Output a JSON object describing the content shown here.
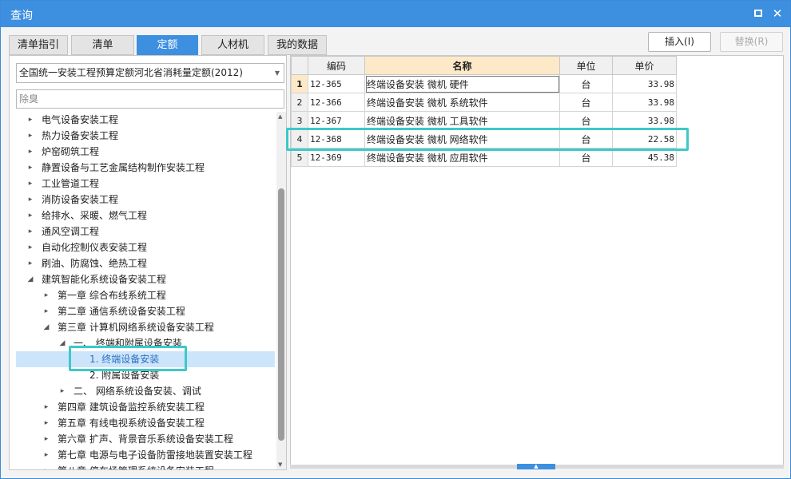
{
  "window": {
    "title": "查询"
  },
  "tabs": [
    {
      "label": "清单指引"
    },
    {
      "label": "清单"
    },
    {
      "label": "定额"
    },
    {
      "label": "人材机"
    },
    {
      "label": "我的数据"
    }
  ],
  "actions": {
    "insert": "插入(I)",
    "replace": "替换(R)"
  },
  "left": {
    "library": "全国统一安装工程预算定额河北省消耗量定额(2012)",
    "search_placeholder": "除臭",
    "tree": [
      {
        "label": "电气设备安装工程",
        "indent": 0,
        "toggle": "▸"
      },
      {
        "label": "热力设备安装工程",
        "indent": 0,
        "toggle": "▸"
      },
      {
        "label": "炉窑砌筑工程",
        "indent": 0,
        "toggle": "▸"
      },
      {
        "label": "静置设备与工艺金属结构制作安装工程",
        "indent": 0,
        "toggle": "▸"
      },
      {
        "label": "工业管道工程",
        "indent": 0,
        "toggle": "▸"
      },
      {
        "label": "消防设备安装工程",
        "indent": 0,
        "toggle": "▸"
      },
      {
        "label": "给排水、采暖、燃气工程",
        "indent": 0,
        "toggle": "▸"
      },
      {
        "label": "通风空调工程",
        "indent": 0,
        "toggle": "▸"
      },
      {
        "label": "自动化控制仪表安装工程",
        "indent": 0,
        "toggle": "▸"
      },
      {
        "label": "刷油、防腐蚀、绝热工程",
        "indent": 0,
        "toggle": "▸"
      },
      {
        "label": "建筑智能化系统设备安装工程",
        "indent": 0,
        "toggle": "◢"
      },
      {
        "label": "第一章 综合布线系统工程",
        "indent": 1,
        "toggle": "▸"
      },
      {
        "label": "第二章 通信系统设备安装工程",
        "indent": 1,
        "toggle": "▸"
      },
      {
        "label": "第三章 计算机网络系统设备安装工程",
        "indent": 1,
        "toggle": "◢"
      },
      {
        "label": "一、 终端和附属设备安装",
        "indent": 2,
        "toggle": "◢"
      },
      {
        "label": "1. 终端设备安装",
        "indent": 3,
        "toggle": "",
        "selected": true
      },
      {
        "label": "2. 附属设备安装",
        "indent": 3,
        "toggle": ""
      },
      {
        "label": "二、 网络系统设备安装、调试",
        "indent": 2,
        "toggle": "▸"
      },
      {
        "label": "第四章 建筑设备监控系统安装工程",
        "indent": 1,
        "toggle": "▸"
      },
      {
        "label": "第五章 有线电视系统设备安装工程",
        "indent": 1,
        "toggle": "▸"
      },
      {
        "label": "第六章 扩声、背景音乐系统设备安装工程",
        "indent": 1,
        "toggle": "▸"
      },
      {
        "label": "第七章 电源与电子设备防雷接地装置安装工程",
        "indent": 1,
        "toggle": "▸"
      },
      {
        "label": "第八章 停车场管理系统设备安装工程",
        "indent": 1,
        "toggle": "▸"
      }
    ]
  },
  "grid": {
    "headers": {
      "code": "编码",
      "name": "名称",
      "unit": "单位",
      "price": "单价"
    },
    "rows": [
      {
        "idx": "1",
        "code": "12-365",
        "name": "终端设备安装 微机 硬件",
        "unit": "台",
        "price": "33.98"
      },
      {
        "idx": "2",
        "code": "12-366",
        "name": "终端设备安装 微机 系统软件",
        "unit": "台",
        "price": "33.98"
      },
      {
        "idx": "3",
        "code": "12-367",
        "name": "终端设备安装 微机 工具软件",
        "unit": "台",
        "price": "33.98"
      },
      {
        "idx": "4",
        "code": "12-368",
        "name": "终端设备安装 微机 网络软件",
        "unit": "台",
        "price": "22.58"
      },
      {
        "idx": "5",
        "code": "12-369",
        "name": "终端设备安装 微机 应用软件",
        "unit": "台",
        "price": "45.38"
      }
    ]
  },
  "icons": {
    "restore": "restore-icon",
    "close": "close-icon"
  }
}
